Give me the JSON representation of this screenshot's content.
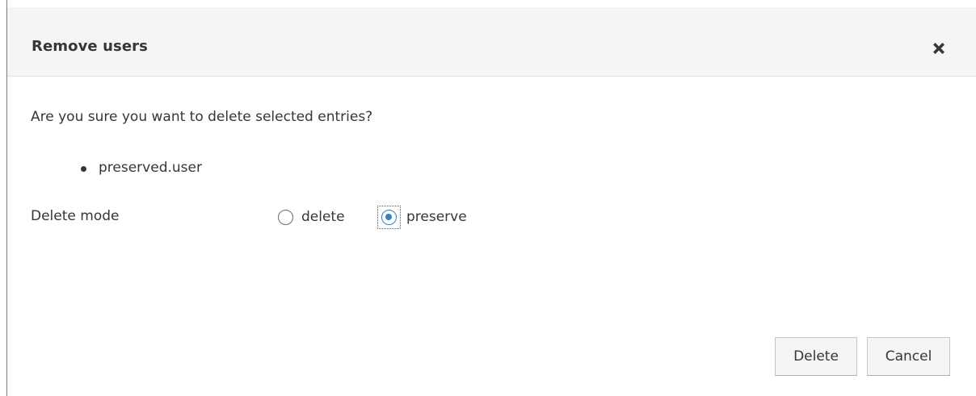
{
  "dialog": {
    "title": "Remove users",
    "close_icon": "close-icon"
  },
  "body": {
    "question": "Are you sure you want to delete selected entries?",
    "entries": [
      "preserved.user"
    ],
    "delete_mode": {
      "label": "Delete mode",
      "options": [
        {
          "label": "delete",
          "checked": false
        },
        {
          "label": "preserve",
          "checked": true
        }
      ],
      "selected": "preserve"
    }
  },
  "footer": {
    "delete_label": "Delete",
    "cancel_label": "Cancel"
  },
  "colors": {
    "accent": "#3a7fbf",
    "header_bg": "#f5f5f5",
    "text": "#363636"
  }
}
